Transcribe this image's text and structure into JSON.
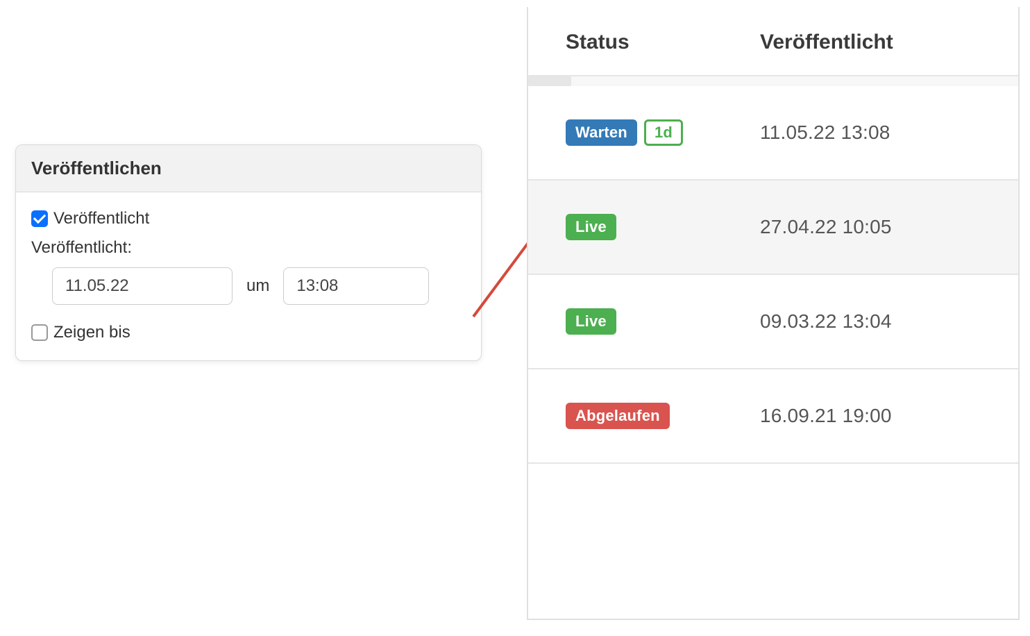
{
  "publish_panel": {
    "title": "Veröffentlichen",
    "published_checkbox_label": "Veröffentlicht",
    "published_checked": true,
    "published_label": "Veröffentlicht:",
    "date_value": "11.05.22",
    "at_label": "um",
    "time_value": "13:08",
    "show_until_label": "Zeigen bis",
    "show_until_checked": false
  },
  "table": {
    "columns": {
      "status": "Status",
      "published": "Veröffentlicht"
    },
    "rows": [
      {
        "status_badge": "Warten",
        "status_badge_color": "blue",
        "extra_badge": "1d",
        "published": "11.05.22 13:08",
        "highlight": false
      },
      {
        "status_badge": "Live",
        "status_badge_color": "green",
        "extra_badge": null,
        "published": "27.04.22 10:05",
        "highlight": true
      },
      {
        "status_badge": "Live",
        "status_badge_color": "green",
        "extra_badge": null,
        "published": "09.03.22 13:04",
        "highlight": false
      },
      {
        "status_badge": "Abgelaufen",
        "status_badge_color": "red",
        "extra_badge": null,
        "published": "16.09.21 19:00",
        "highlight": false
      }
    ]
  },
  "colors": {
    "blue": "#337ab7",
    "green": "#4caf50",
    "red": "#d9534f",
    "arrow": "#d44a3a"
  }
}
